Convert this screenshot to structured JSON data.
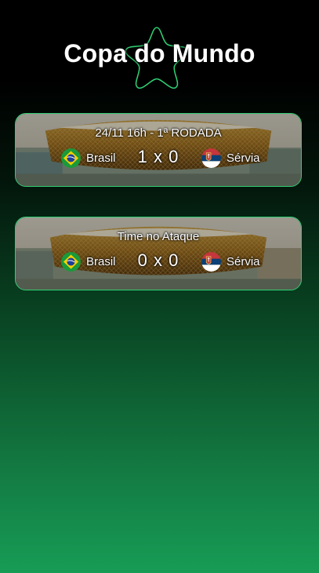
{
  "header": {
    "title": "Copa do Mundo",
    "logo_icon": "star-outline-icon"
  },
  "matches": [
    {
      "label": "24/11 16h - 1ª RODADA",
      "home": {
        "name": "Brasil",
        "flag_icon": "brazil-flag-icon"
      },
      "away": {
        "name": "Sérvia",
        "flag_icon": "serbia-flag-icon"
      },
      "score": "1 x 0"
    },
    {
      "label": "Time no Ataque",
      "home": {
        "name": "Brasil",
        "flag_icon": "brazil-flag-icon"
      },
      "away": {
        "name": "Sérvia",
        "flag_icon": "serbia-flag-icon"
      },
      "score": "0 x 0"
    }
  ],
  "colors": {
    "accent_border": "#2fcf73",
    "gradient_bottom": "#179c55"
  }
}
